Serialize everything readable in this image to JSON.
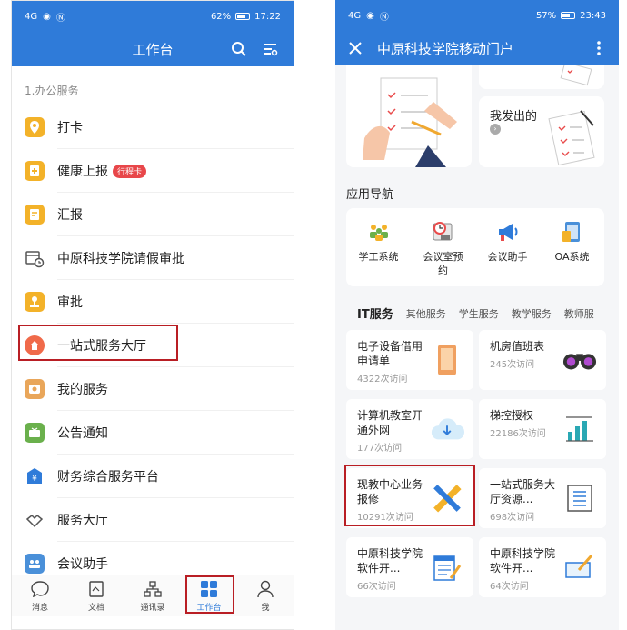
{
  "left": {
    "status": {
      "signal": "4G",
      "battery": "62%",
      "time": "17:22"
    },
    "header": {
      "title": "工作台"
    },
    "section": "1.办公服务",
    "items": [
      {
        "label": "打卡",
        "icon": "location-pin-icon",
        "color": "#f3b229"
      },
      {
        "label": "健康上报",
        "tag": "行程卡",
        "icon": "health-report-icon",
        "color": "#f3b229"
      },
      {
        "label": "汇报",
        "icon": "report-icon",
        "color": "#f3b229"
      },
      {
        "label": "中原科技学院请假审批",
        "icon": "calendar-clock-icon",
        "color": "#555555"
      },
      {
        "label": "审批",
        "icon": "approval-stamp-icon",
        "color": "#f3b229"
      },
      {
        "label": "一站式服务大厅",
        "icon": "home-icon",
        "color": "#f06a4a"
      },
      {
        "label": "我的服务",
        "icon": "my-service-icon",
        "color": "#e9a65a"
      },
      {
        "label": "公告通知",
        "icon": "notice-icon",
        "color": "#6ab04c"
      },
      {
        "label": "财务综合服务平台",
        "icon": "finance-icon",
        "color": "#2f7bd9"
      },
      {
        "label": "服务大厅",
        "icon": "handshake-icon",
        "color": "#555555"
      },
      {
        "label": "会议助手",
        "icon": "meeting-people-icon",
        "color": "#4a90d9"
      }
    ],
    "tabs": [
      {
        "label": "消息",
        "icon": "chat-bubble-icon"
      },
      {
        "label": "文档",
        "icon": "document-icon"
      },
      {
        "label": "通讯录",
        "icon": "org-chart-icon"
      },
      {
        "label": "工作台",
        "icon": "grid-icon",
        "active": true
      },
      {
        "label": "我",
        "icon": "person-icon"
      }
    ]
  },
  "right": {
    "status": {
      "signal": "4G",
      "battery": "57%",
      "time": "23:43"
    },
    "header": {
      "title": "中原科技学院移动门户"
    },
    "sent_card": {
      "title": "我发出的"
    },
    "nav_title": "应用导航",
    "apps": [
      {
        "label": "学工系统",
        "icon": "students-icon"
      },
      {
        "label": "会议室预约",
        "icon": "meeting-room-clock-icon"
      },
      {
        "label": "会议助手",
        "icon": "megaphone-icon"
      },
      {
        "label": "OA系统",
        "icon": "devices-icon"
      }
    ],
    "service_tabs": [
      "IT服务",
      "其他服务",
      "学生服务",
      "教学服务",
      "教师服"
    ],
    "tiles": [
      {
        "title": "电子设备借用申请单",
        "visits": "4322次访问",
        "icon": "phone-device-icon"
      },
      {
        "title": "机房值班表",
        "visits": "245次访问",
        "icon": "binoculars-icon"
      },
      {
        "title": "计算机教室开通外网",
        "visits": "177次访问",
        "icon": "cloud-download-icon"
      },
      {
        "title": "梯控授权",
        "visits": "22186次访问",
        "icon": "bar-chart-icon"
      },
      {
        "title": "现教中心业务报修",
        "visits": "10291次访问",
        "icon": "pencil-ruler-icon"
      },
      {
        "title": "一站式服务大厅资源...",
        "visits": "698次访问",
        "icon": "list-doc-icon"
      },
      {
        "title": "中原科技学院软件开...",
        "visits": "66次访问",
        "icon": "form-pencil-icon"
      },
      {
        "title": "中原科技学院软件开...",
        "visits": "64次访问",
        "icon": "screen-pencil-icon"
      }
    ]
  }
}
